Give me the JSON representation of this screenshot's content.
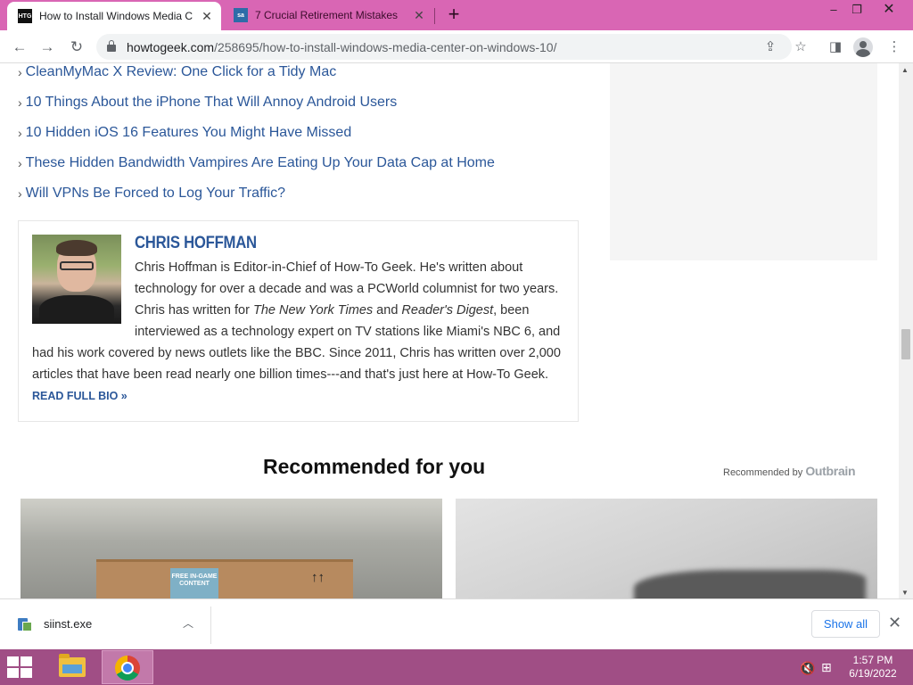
{
  "browser": {
    "tabs": [
      {
        "favicon": "HTG",
        "title": "How to Install Windows Media C",
        "active": true
      },
      {
        "favicon": "sa",
        "title": "7 Crucial Retirement Mistakes",
        "active": false
      }
    ],
    "new_tab_icon": "+",
    "window_controls": {
      "minimize": "–",
      "restore": "❐",
      "close": "✕"
    },
    "url_host": "howtogeek.com",
    "url_path": "/258695/how-to-install-windows-media-center-on-windows-10/"
  },
  "page": {
    "related_links": [
      "CleanMyMac X Review: One Click for a Tidy Mac",
      "10 Things About the iPhone That Will Annoy Android Users",
      "10 Hidden iOS 16 Features You Might Have Missed",
      "These Hidden Bandwidth Vampires Are Eating Up Your Data Cap at Home",
      "Will VPNs Be Forced to Log Your Traffic?"
    ],
    "author": {
      "name": "CHRIS HOFFMAN",
      "bio_1": "Chris Hoffman is Editor-in-Chief of How-To Geek. He's written about technology for over a decade and was a PCWorld columnist for two years. Chris has written for ",
      "bio_nyt": "The New York Times",
      "bio_and": " and ",
      "bio_rd": "Reader's Digest",
      "bio_2": ", been interviewed as a technology expert on TV stations like Miami's NBC 6, and had his work covered by news outlets like the BBC. Since 2011, Chris has written over 2,000 articles that have been read nearly one billion times---and that's just here at How-To Geek. ",
      "read_more": "READ FULL BIO »"
    },
    "recommended": {
      "title": "Recommended for you",
      "by_label": "Recommended by",
      "brand": "Outbrain",
      "image1_label": "FREE IN-GAME CONTENT"
    }
  },
  "downloads": {
    "file_name": "siinst.exe",
    "show_all": "Show all"
  },
  "taskbar": {
    "time": "1:57 PM",
    "date": "6/19/2022"
  }
}
